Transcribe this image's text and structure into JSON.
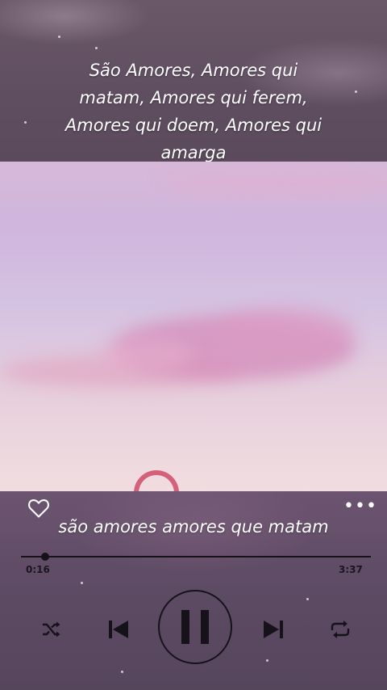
{
  "lyrics_top": {
    "lines": [
      "São Amores, Amores qui",
      "matam, Amores qui ferem,",
      "Amores qui doem, Amores qui",
      "amarga"
    ]
  },
  "player": {
    "current_lyric": "são amores amores que matam",
    "time_elapsed": "0:16",
    "time_total": "3:37",
    "progress_fraction": 0.07,
    "icons": {
      "like": "heart-icon",
      "more": "more-options-icon",
      "shuffle": "shuffle-icon",
      "previous": "skip-previous-icon",
      "play_pause": "pause-icon",
      "next": "skip-next-icon",
      "repeat": "repeat-icon"
    },
    "more_label": "•••"
  },
  "colors": {
    "lyrics_text": "#ffffff",
    "controls": "#16121a",
    "player_bg": "#5d4a63"
  }
}
